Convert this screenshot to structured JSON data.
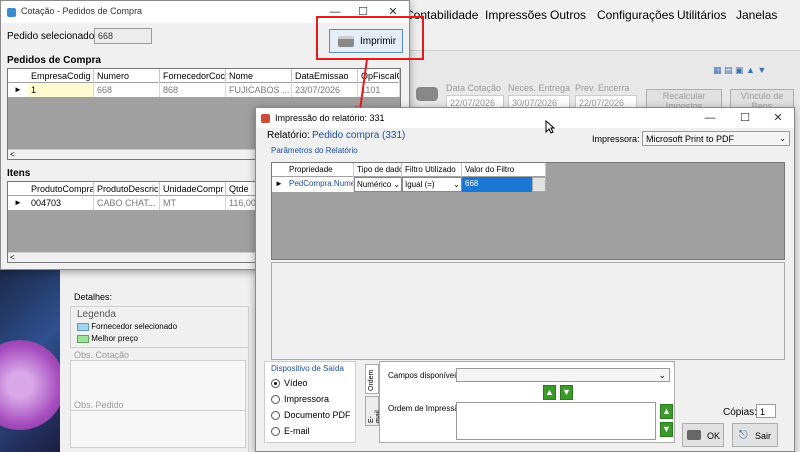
{
  "menu": {
    "items": [
      "Contabilidade",
      "Impressões",
      "Outros",
      "Configurações",
      "Utilitários",
      "Janelas"
    ]
  },
  "cotacao": {
    "title": "Cotação - Pedidos de Compra",
    "selected_label": "Pedido selecionado:",
    "selected_value": "668",
    "print_button": "Imprimir",
    "pedidos_title": "Pedidos de Compra",
    "pedidos_cols": [
      "EmpresaCodig",
      "Numero",
      "FornecedorCoc",
      "Nome",
      "DataEmissao",
      "OpFiscalC"
    ],
    "pedidos_row": [
      "1",
      "668",
      "868",
      "FUJICABOS ...",
      "23/07/2026",
      "1101"
    ],
    "itens_title": "Itens",
    "itens_cols": [
      "ProdutoCompra",
      "ProdutoDescric",
      "UnidadeCompr",
      "Qtde"
    ],
    "itens_row": [
      "004703",
      "CABO CHAT...",
      "MT",
      "116,0000"
    ]
  },
  "background": {
    "col_headers": [
      "Data Cotação",
      "Neces. Entrega",
      "Prev. Encerra"
    ],
    "dates": [
      "22/07/2026",
      "30/07/2026",
      "22/07/2026"
    ],
    "btn_recalc": "Recalcular Impostos",
    "btn_vinculo": "Vínculo de Bens",
    "detalhes": "Detalhes:",
    "legenda": "Legenda",
    "legend_items": [
      {
        "label": "Fornecedor selecionado",
        "color": "#9fd4f0"
      },
      {
        "label": "Melhor preço",
        "color": "#9ce39c"
      }
    ],
    "obs_cotacao": "Obs. Cotação",
    "obs_pedido": "Obs. Pedido"
  },
  "report": {
    "title": "Impressão do relatório: 331",
    "relatorio_label": "Relatório:",
    "relatorio_value": "Pedido compra (331)",
    "impressora_label": "Impressora:",
    "impressora_value": "Microsoft Print to PDF",
    "params_title": "Parâmetros do Relatório",
    "params_cols": [
      "Propriedade",
      "Tipo de dado",
      "Filtro Utilizado",
      "Valor do Filtro"
    ],
    "params_row": {
      "propriedade": "PedCompra.Numero",
      "tipo": "Numérico",
      "filtro": "Igual (=)",
      "valor": "668"
    },
    "dispositivo_title": "Dispositivo de Saída",
    "dispositivos": [
      {
        "label": "Vídeo",
        "checked": true
      },
      {
        "label": "Impressora",
        "checked": false
      },
      {
        "label": "Documento PDF",
        "checked": false
      },
      {
        "label": "E-mail",
        "checked": false
      }
    ],
    "tabs": [
      "Ordem",
      "E-mail"
    ],
    "campos_label": "Campos disponíveis:",
    "ordem_label": "Ordem de Impressão:",
    "copias_label": "Cópias:",
    "copias_value": "1",
    "ok_label": "OK",
    "sair_label": "Sair"
  }
}
